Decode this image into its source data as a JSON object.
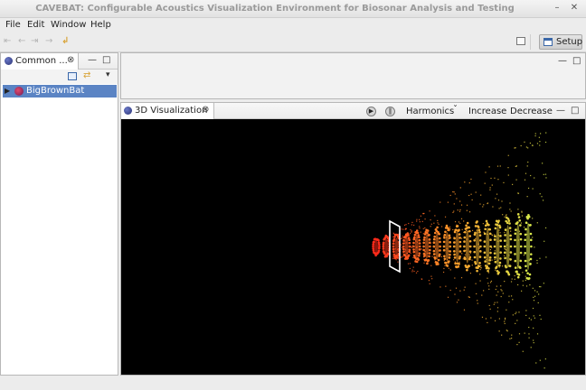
{
  "window": {
    "title": "CAVEBAT: Configurable Acoustics Visualization Environment for Biosonar Analysis and Testing",
    "min_glyph": "–",
    "close_glyph": "✕"
  },
  "menu": [
    "File",
    "Edit",
    "Window",
    "Help"
  ],
  "toolbar": {
    "icons": [
      "⇤",
      "←",
      "⇥",
      "→",
      "↲"
    ],
    "setup_label": "Setup"
  },
  "left_panel": {
    "tab_label": "Common ...",
    "close_glyph": "⊗",
    "tree": [
      {
        "label": "BigBrownBat",
        "expander": "▶"
      }
    ]
  },
  "viz": {
    "tab_label": "3D Visualization",
    "close_glyph": "⊗",
    "play_glyph": "▶",
    "pause_glyph": "‖",
    "harmonics_label": "Harmonics",
    "harmonics_arrow": "ˇ",
    "increase_label": "Increase",
    "decrease_label": "Decrease"
  },
  "panel_controls": {
    "minimize": "—",
    "maximize": "□"
  },
  "colors": {
    "selection": "#5b84c4",
    "beam_near": "#ff2a1a",
    "beam_mid": "#ff9a2a",
    "beam_far": "#d9e84a",
    "viz_background": "#000000"
  }
}
